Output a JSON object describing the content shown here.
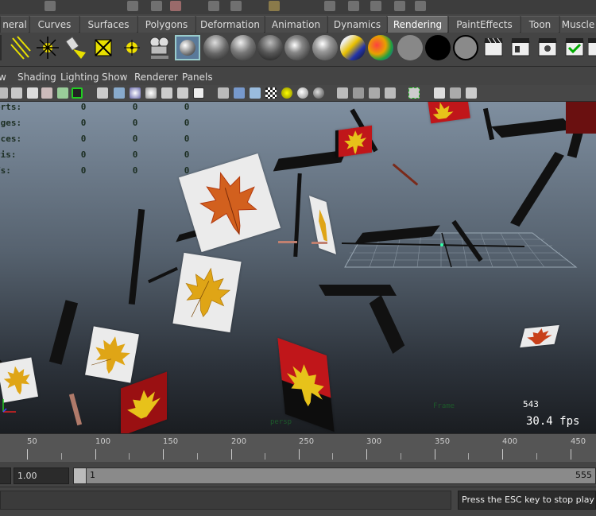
{
  "shelf_tabs": [
    {
      "label": "neral",
      "active": false
    },
    {
      "label": "Curves",
      "active": false
    },
    {
      "label": "Surfaces",
      "active": false
    },
    {
      "label": "Polygons",
      "active": false
    },
    {
      "label": "Deformation",
      "active": false
    },
    {
      "label": "Animation",
      "active": false
    },
    {
      "label": "Dynamics",
      "active": false
    },
    {
      "label": "Rendering",
      "active": true
    },
    {
      "label": "PaintEffects",
      "active": false
    },
    {
      "label": "Toon",
      "active": false
    },
    {
      "label": "Muscle",
      "active": false
    }
  ],
  "shelf_icons": [
    "directional-light-icon",
    "spot-light-icon",
    "point-light-icon",
    "area-light-icon",
    "volume-light-icon",
    "ambient-light-icon",
    "camera-icon",
    "material-sphere-icon",
    "lambert-sphere-icon",
    "blinn-sphere-icon",
    "phong-sphere-icon",
    "phonge-sphere-icon",
    "anisotropic-sphere-icon",
    "layered-shader-icon",
    "ramp-shader-icon",
    "surface-shader-icon",
    "black-sphere-icon",
    "use-background-icon",
    "render-current-frame-icon",
    "ipr-render-icon",
    "render-settings-icon",
    "hypershade-icon",
    "batch-render-icon"
  ],
  "panel_menu": [
    "w",
    "Shading",
    "Lighting",
    "Show",
    "Renderer",
    "Panels"
  ],
  "hud_stats": {
    "rows": [
      {
        "label": "erts:",
        "values": [
          "0",
          "0",
          "0"
        ]
      },
      {
        "label": "dges:",
        "values": [
          "0",
          "0",
          "0"
        ]
      },
      {
        "label": "aces:",
        "values": [
          "0",
          "0",
          "0"
        ]
      },
      {
        "label": "ris:",
        "values": [
          "0",
          "0",
          "0"
        ]
      },
      {
        "label": "Vs:",
        "values": [
          "0",
          "0",
          "0"
        ]
      }
    ]
  },
  "viewport": {
    "frame_number": "543",
    "fps": "30.4 fps",
    "hud_persp": "persp",
    "hud_frame": "Frame"
  },
  "timeline": {
    "labels": [
      "50",
      "100",
      "150",
      "200",
      "250",
      "300",
      "350",
      "400",
      "450"
    ]
  },
  "range": {
    "start_field": "1.00",
    "range_start": "1",
    "range_end": "555"
  },
  "status": {
    "message": "Press the ESC key to stop playback."
  },
  "colors": {
    "active_tab": "#6a6a6a",
    "leaf_red": "#c0161a",
    "leaf_orange": "#d2601e",
    "leaf_yellow": "#dfa516"
  }
}
